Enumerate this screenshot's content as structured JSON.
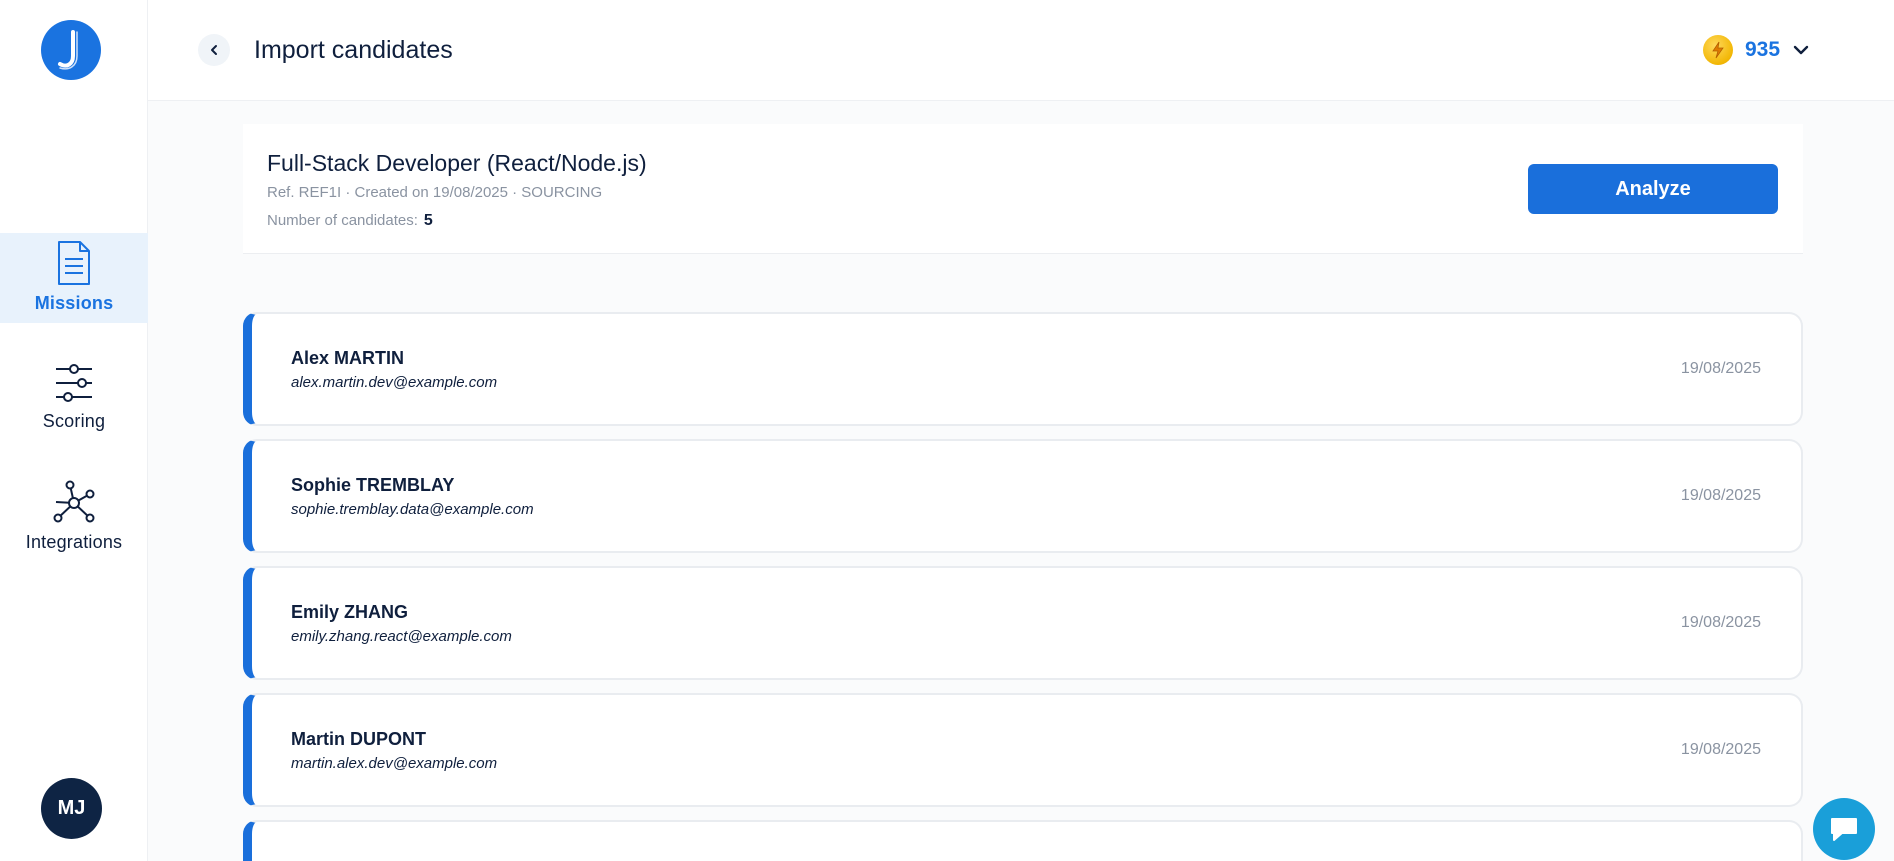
{
  "app": {
    "logo_letter": "J",
    "brand_color": "#1a73e0"
  },
  "sidebar": {
    "items": [
      {
        "label": "Missions",
        "icon": "document-icon",
        "active": true
      },
      {
        "label": "Scoring",
        "icon": "sliders-icon",
        "active": false
      },
      {
        "label": "Integrations",
        "icon": "network-icon",
        "active": false
      }
    ],
    "avatar_initials": "MJ"
  },
  "header": {
    "title": "Import candidates",
    "credits": "935"
  },
  "mission": {
    "title": "Full-Stack Developer (React/Node.js)",
    "meta": "Ref. REF1I · Created on 19/08/2025 · SOURCING",
    "count_label": "Number of candidates:",
    "count_value": "5",
    "analyze_label": "Analyze"
  },
  "candidates": [
    {
      "name": "Alex MARTIN",
      "email": "alex.martin.dev@example.com",
      "date": "19/08/2025"
    },
    {
      "name": "Sophie TREMBLAY",
      "email": "sophie.tremblay.data@example.com",
      "date": "19/08/2025"
    },
    {
      "name": "Emily ZHANG",
      "email": "emily.zhang.react@example.com",
      "date": "19/08/2025"
    },
    {
      "name": "Martin DUPONT",
      "email": "martin.alex.dev@example.com",
      "date": "19/08/2025"
    },
    {
      "name": "",
      "email": "",
      "date": ""
    }
  ]
}
